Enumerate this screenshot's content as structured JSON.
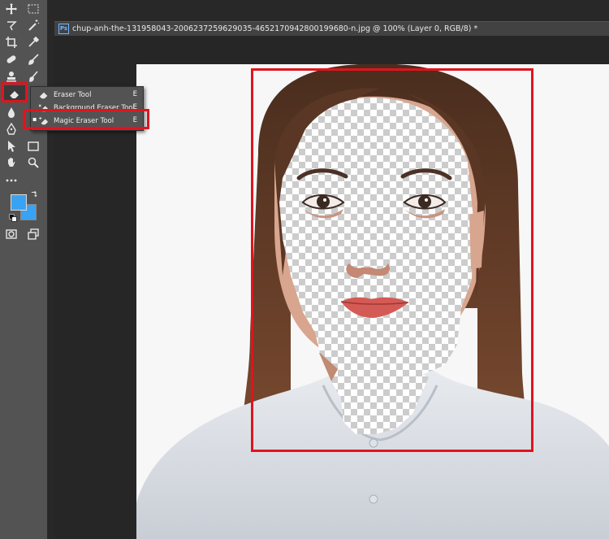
{
  "document": {
    "ps_badge": "Ps",
    "tab_title": "chup-anh-the-131958043-2006237259629035-4652170942800199680-n.jpg @ 100% (Layer 0, RGB/8) *"
  },
  "toolbar": {
    "tools": [
      "move-tool",
      "marquee-tool",
      "lasso-tool",
      "magic-wand-tool",
      "crop-tool",
      "eyedropper-tool",
      "healing-brush-tool",
      "brush-tool",
      "clone-stamp-tool",
      "history-brush-tool",
      "eraser-tool",
      "gradient-tool",
      "blur-tool",
      "dodge-tool",
      "pen-tool",
      "type-tool",
      "path-selection-tool",
      "rectangle-tool",
      "hand-tool",
      "zoom-tool",
      "more-tools"
    ],
    "foreground_color": "#3aa2f2",
    "background_color": "#3aa2f2"
  },
  "flyout": {
    "items": [
      {
        "label": "Eraser Tool",
        "shortcut": "E"
      },
      {
        "label": "Background Eraser Tool",
        "shortcut": "E"
      },
      {
        "label": "Magic Eraser Tool",
        "shortcut": "E",
        "bullet": "▪"
      }
    ]
  },
  "colors": {
    "highlight": "#e0141e",
    "panel": "#535353",
    "workspace": "#282828"
  }
}
